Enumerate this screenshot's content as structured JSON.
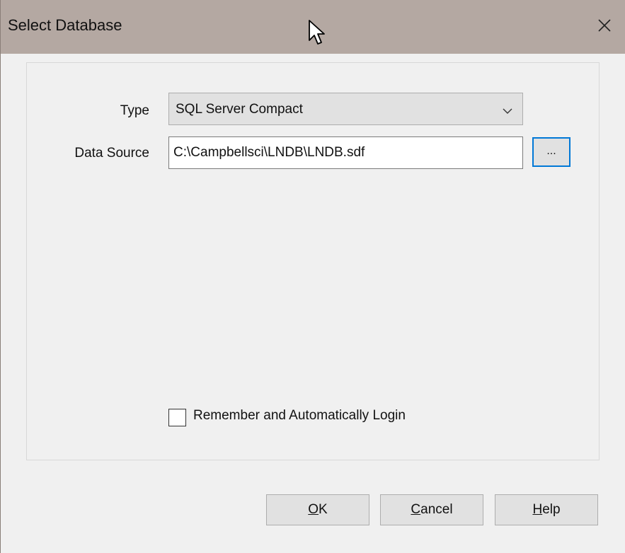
{
  "window": {
    "title": "Select Database",
    "close_glyph": "✕"
  },
  "form": {
    "type_label": "Type",
    "type_value": "SQL Server Compact",
    "data_source_label": "Data Source",
    "data_source_value": "C:\\Campbellsci\\LNDB\\LNDB.sdf",
    "browse_label": "...",
    "remember_label": "Remember and Automatically Login",
    "remember_checked": false
  },
  "buttons": {
    "ok": {
      "mnemonic": "O",
      "rest": "K"
    },
    "cancel": {
      "mnemonic": "C",
      "rest": "ancel"
    },
    "help": {
      "mnemonic": "H",
      "rest": "elp"
    }
  },
  "icons": {
    "close": "close-icon",
    "dropdown": "chevron-down-icon",
    "cursor": "mouse-pointer-icon"
  },
  "colors": {
    "titlebar": "#b4a8a2",
    "dialog_bg": "#f0f0f0",
    "focus_border": "#0078d7"
  }
}
